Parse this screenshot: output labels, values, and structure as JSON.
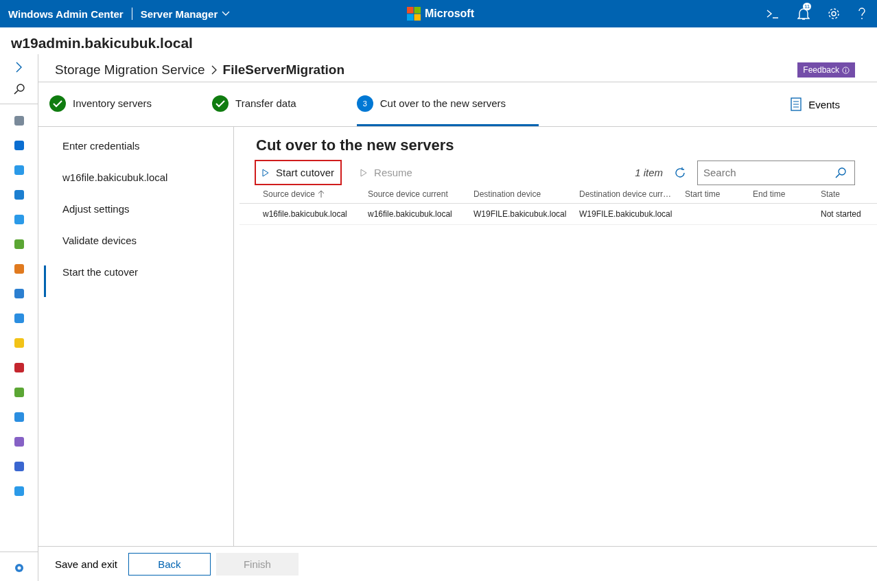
{
  "top_bar": {
    "brand": "Windows Admin Center",
    "tool": "Server Manager",
    "logo_text": "Microsoft",
    "notification_count": "11"
  },
  "server_title": "w19admin.bakicubuk.local",
  "breadcrumb": {
    "parent": "Storage Migration Service",
    "current": "FileServerMigration"
  },
  "feedback_button": "Feedback",
  "steps": [
    {
      "label": "Inventory servers",
      "kind": "done",
      "selected": false
    },
    {
      "label": "Transfer data",
      "kind": "done",
      "selected": false
    },
    {
      "label": "Cut over to the new servers",
      "kind": "current",
      "number": "3",
      "selected": true
    }
  ],
  "events_button": "Events",
  "nav": [
    {
      "label": "Enter credentials",
      "selected": false
    },
    {
      "label": "w16file.bakicubuk.local",
      "selected": false
    },
    {
      "label": "Adjust settings",
      "selected": false
    },
    {
      "label": "Validate devices",
      "selected": false
    },
    {
      "label": "Start the cutover",
      "selected": true
    }
  ],
  "heading": "Cut over to the new servers",
  "toolbar": [
    {
      "label": "Start cutover",
      "disabled": false,
      "highlighted": true
    },
    {
      "label": "Resume",
      "disabled": true,
      "highlighted": false
    }
  ],
  "item_count": "1 item",
  "search": {
    "placeholder": "Search"
  },
  "table": {
    "columns": [
      {
        "label": "Source device",
        "sorted": true
      },
      {
        "label": "Source device current",
        "sorted": false
      },
      {
        "label": "Destination device",
        "sorted": false
      },
      {
        "label": "Destination device curr…",
        "sorted": false
      },
      {
        "label": "Start time",
        "sorted": false
      },
      {
        "label": "End time",
        "sorted": false
      },
      {
        "label": "State",
        "sorted": false
      }
    ],
    "rows": [
      [
        "w16file.bakicubuk.local",
        "w16file.bakicubuk.local",
        "W19FILE.bakicubuk.local",
        "W19FILE.bakicubuk.local",
        "",
        "",
        "Not started"
      ]
    ]
  },
  "footer": {
    "save_exit": "Save and exit",
    "back": "Back",
    "finish": "Finish",
    "finish_disabled": true
  }
}
